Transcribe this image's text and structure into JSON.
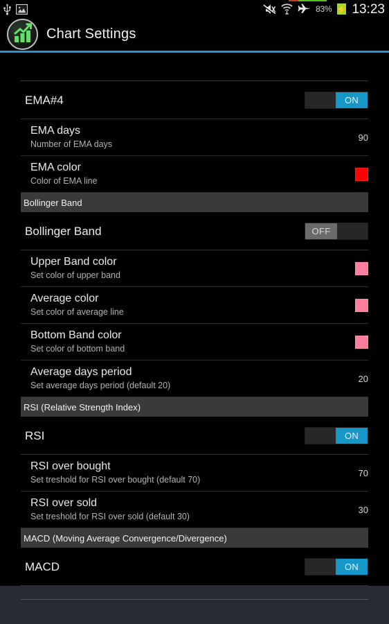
{
  "statusbar": {
    "left_icons": [
      "usb-icon",
      "screenshot-image-icon"
    ],
    "right_icons": [
      "ringer-silent-icon",
      "wifi-icon",
      "airplane-mode-icon"
    ],
    "battery_percent": "83%",
    "battery_state_icon": "battery-charging-icon",
    "clock": "13:23"
  },
  "actionbar": {
    "icon": "chart-app-icon",
    "title": "Chart Settings"
  },
  "sections": [
    {
      "header": null,
      "rows": [
        {
          "kind": "switch",
          "name": "ema4",
          "label": "EMA#4",
          "switch_state": "ON"
        },
        {
          "kind": "value",
          "name": "ema-days",
          "title": "EMA days",
          "summary": "Number of EMA days",
          "value": "90"
        },
        {
          "kind": "color",
          "name": "ema-color",
          "title": "EMA color",
          "summary": "Color of EMA line",
          "color": "#FF0000"
        }
      ]
    },
    {
      "header": "Bollinger Band",
      "rows": [
        {
          "kind": "switch",
          "name": "bollinger-band",
          "label": "Bollinger Band",
          "switch_state": "OFF"
        },
        {
          "kind": "color",
          "name": "upper-band-color",
          "title": "Upper Band color",
          "summary": "Set color of upper band",
          "color": "#FC7F9E"
        },
        {
          "kind": "color",
          "name": "average-color",
          "title": "Average color",
          "summary": "Set color of average line",
          "color": "#FC7F9E"
        },
        {
          "kind": "color",
          "name": "bottom-band-color",
          "title": "Bottom Band color",
          "summary": "Set color of bottom band",
          "color": "#FC7F9E"
        },
        {
          "kind": "value",
          "name": "average-days-period",
          "title": "Average days period",
          "summary": "Set average days period (default 20)",
          "value": "20"
        }
      ]
    },
    {
      "header": "RSI (Relative Strength Index)",
      "rows": [
        {
          "kind": "switch",
          "name": "rsi",
          "label": "RSI",
          "switch_state": "ON"
        },
        {
          "kind": "value",
          "name": "rsi-over-bought",
          "title": "RSI over bought",
          "summary": "Set treshold for RSI over bought (default 70)",
          "value": "70"
        },
        {
          "kind": "value",
          "name": "rsi-over-sold",
          "title": "RSI over sold",
          "summary": "Set treshold for RSI over sold (default 30)",
          "value": "30"
        }
      ]
    },
    {
      "header": "MACD (Moving Average Convergence/Divergence)",
      "rows": [
        {
          "kind": "switch",
          "name": "macd",
          "label": "MACD",
          "switch_state": "ON"
        }
      ]
    }
  ],
  "colors": {
    "accent_blue": "#2196d6",
    "switch_on": "#1697c8",
    "switch_off_thumb": "#6b6b6b",
    "section_header_bg": "#3a3a3a",
    "background": "#000000",
    "footer_background": "#272b33"
  }
}
